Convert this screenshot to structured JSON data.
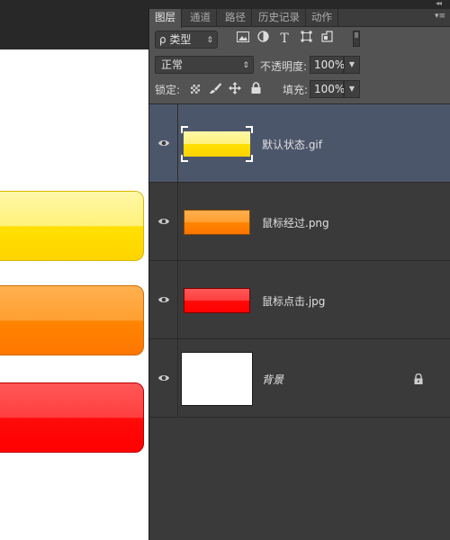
{
  "panel": {
    "tabs": [
      {
        "label": "图层",
        "active": true
      },
      {
        "label": "通道",
        "active": false
      },
      {
        "label": "路径",
        "active": false
      },
      {
        "label": "历史记录",
        "active": false
      },
      {
        "label": "动作",
        "active": false
      }
    ],
    "collapse_glyph": "◂◂",
    "menu_glyph": "▾≡"
  },
  "filter": {
    "type_label": "ρ 类型",
    "arrow": "⇕",
    "icons": [
      "image-filter-icon",
      "adjustment-filter-icon",
      "type-filter-icon",
      "shape-filter-icon",
      "smart-object-filter-icon"
    ]
  },
  "blend": {
    "mode": "正常",
    "mode_arrow": "⇕",
    "opacity_label": "不透明度:",
    "opacity_value": "100%",
    "step_arrow": "▼"
  },
  "lock": {
    "label": "锁定:",
    "icons": [
      "lock-transparent-icon",
      "lock-pixels-icon",
      "lock-position-icon",
      "lock-all-icon"
    ],
    "fill_label": "填充:",
    "fill_value": "100%",
    "step_arrow": "▼"
  },
  "layers": [
    {
      "name": "默认状态.gif",
      "selected": true,
      "visible": true
    },
    {
      "name": "鼠标经过.png",
      "selected": false,
      "visible": true
    },
    {
      "name": "鼠标点击.jpg",
      "selected": false,
      "visible": true
    },
    {
      "name": "背景",
      "selected": false,
      "visible": true,
      "locked": true,
      "italic": true
    }
  ],
  "colors": {
    "panel_bg": "#535353",
    "list_bg": "#3a3a3a",
    "selected_row": "#4c566b",
    "canvas_bg": "#ffffff",
    "button_yellow": "#ffe000",
    "button_orange": "#ff8500",
    "button_red": "#ff0000"
  }
}
